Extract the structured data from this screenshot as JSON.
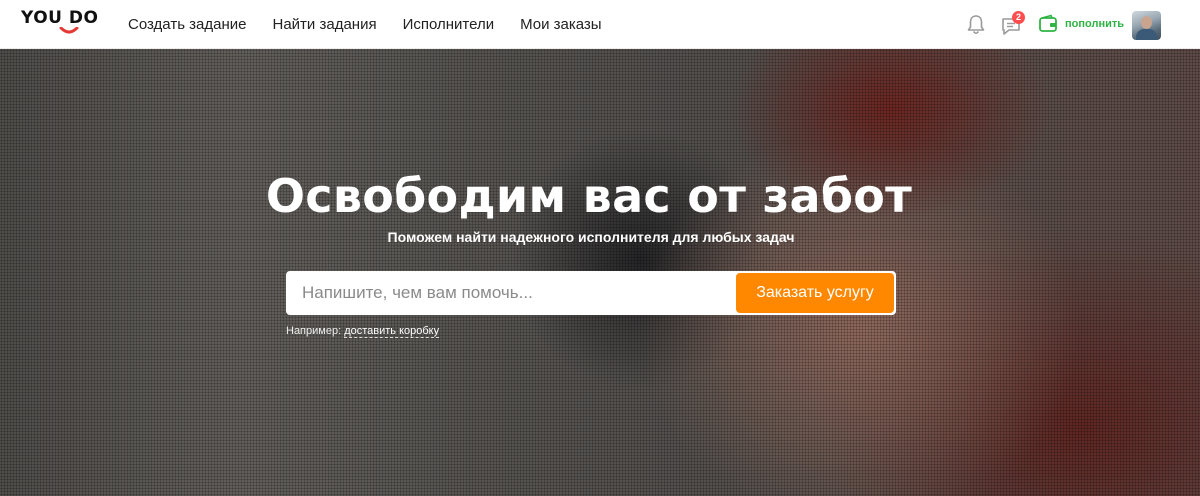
{
  "header": {
    "logo_text": "YOU DO",
    "nav": [
      {
        "label": "Создать задание"
      },
      {
        "label": "Найти задания"
      },
      {
        "label": "Исполнители"
      },
      {
        "label": "Мои заказы"
      }
    ],
    "chat_badge": "2",
    "topup_label": "пополнить",
    "colors": {
      "accent_green": "#2fb344",
      "badge_red": "#ff4d4f",
      "logo_red": "#e53935"
    }
  },
  "hero": {
    "title": "Освободим вас от забот",
    "subtitle": "Поможем найти надежного исполнителя для любых задач",
    "search_placeholder": "Напишите, чем вам помочь...",
    "order_button_label": "Заказать услугу",
    "example_prefix": "Например:",
    "example_link": "доставить коробку",
    "colors": {
      "button_orange": "#ff8800"
    }
  }
}
